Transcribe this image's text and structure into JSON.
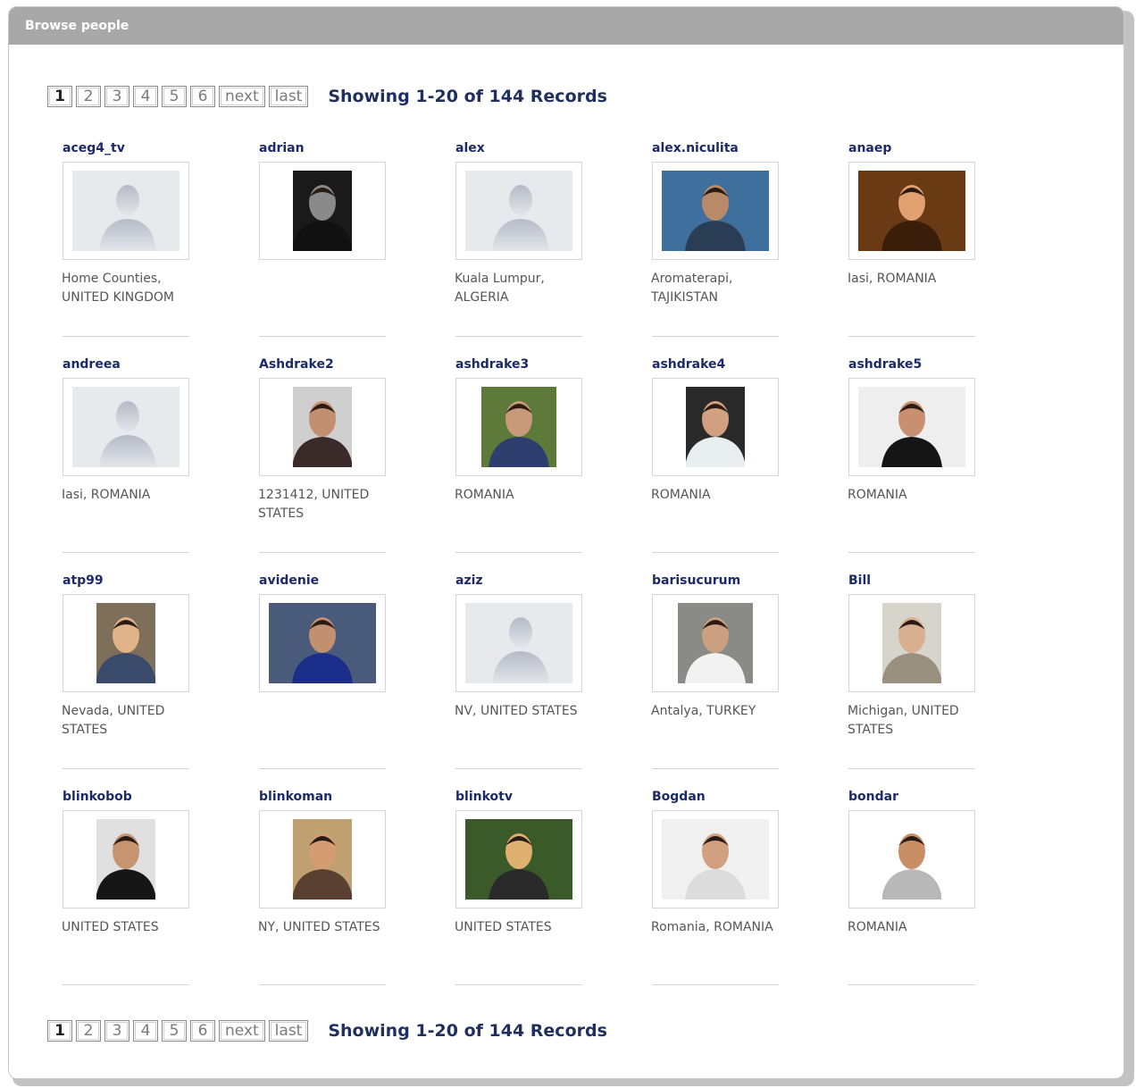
{
  "header": {
    "title": "Browse people"
  },
  "pager": {
    "pages": [
      "1",
      "2",
      "3",
      "4",
      "5",
      "6"
    ],
    "current": "1",
    "next_label": "next",
    "last_label": "last",
    "summary": "Showing 1-20 of 144 Records"
  },
  "people": [
    {
      "username": "aceg4_tv",
      "location": "Home Counties, UNITED KINGDOM",
      "photo": "default-avatar"
    },
    {
      "username": "adrian",
      "location": "",
      "photo": "photo"
    },
    {
      "username": "alex",
      "location": "Kuala Lumpur, ALGERIA",
      "photo": "default-avatar"
    },
    {
      "username": "alex.niculita",
      "location": "Aromaterapi, TAJIKISTAN",
      "photo": "photo"
    },
    {
      "username": "anaep",
      "location": "Iasi, ROMANIA",
      "photo": "photo"
    },
    {
      "username": "andreea",
      "location": "Iasi, ROMANIA",
      "photo": "default-avatar"
    },
    {
      "username": "Ashdrake2",
      "location": "1231412, UNITED STATES",
      "photo": "photo"
    },
    {
      "username": "ashdrake3",
      "location": "ROMANIA",
      "photo": "photo"
    },
    {
      "username": "ashdrake4",
      "location": "ROMANIA",
      "photo": "photo"
    },
    {
      "username": "ashdrake5",
      "location": "ROMANIA",
      "photo": "photo"
    },
    {
      "username": "atp99",
      "location": "Nevada, UNITED STATES",
      "photo": "photo"
    },
    {
      "username": "avidenie",
      "location": "",
      "photo": "photo"
    },
    {
      "username": "aziz",
      "location": "NV, UNITED STATES",
      "photo": "default-avatar"
    },
    {
      "username": "barisucurum",
      "location": "Antalya, TURKEY",
      "photo": "photo"
    },
    {
      "username": "Bill",
      "location": "Michigan, UNITED STATES",
      "photo": "photo"
    },
    {
      "username": "blinkobob",
      "location": "UNITED STATES",
      "photo": "photo"
    },
    {
      "username": "blinkoman",
      "location": "NY, UNITED STATES",
      "photo": "photo"
    },
    {
      "username": "blinkotv",
      "location": "UNITED STATES",
      "photo": "photo"
    },
    {
      "username": "Bogdan",
      "location": "Romania, ROMANIA",
      "photo": "photo"
    },
    {
      "username": "bondar",
      "location": "ROMANIA",
      "photo": "photo"
    }
  ]
}
